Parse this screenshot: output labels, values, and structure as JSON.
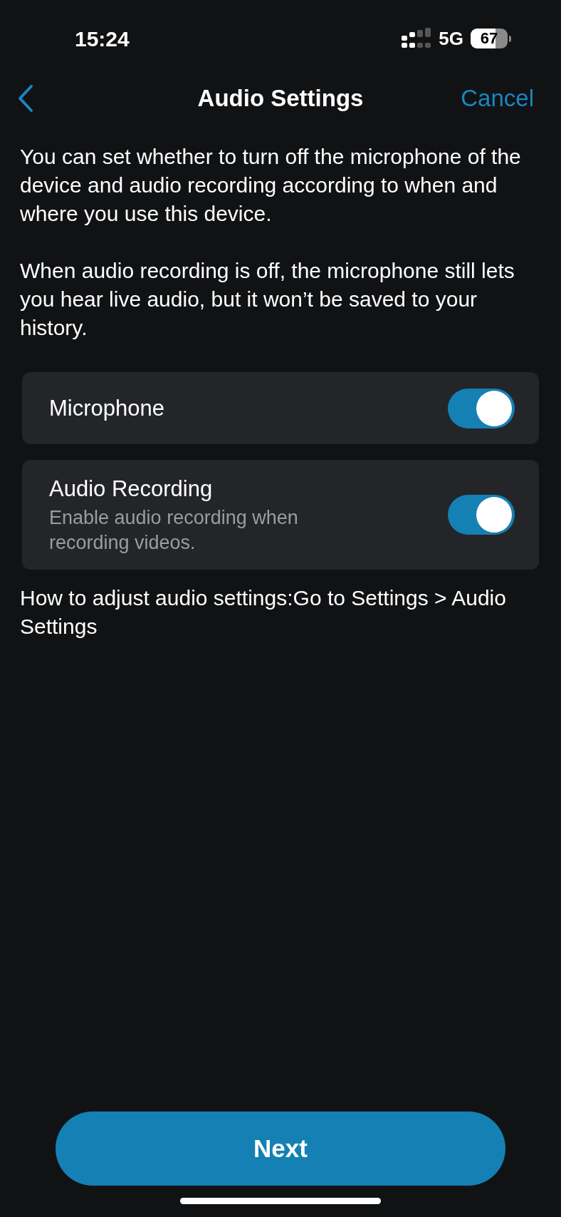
{
  "status_bar": {
    "time": "15:24",
    "network": "5G",
    "battery": "67"
  },
  "nav": {
    "title": "Audio Settings",
    "cancel": "Cancel"
  },
  "paragraphs": [
    "You can set whether to turn off the microphone of the device and audio recording according to when and where you use this device.",
    "When audio recording is off, the microphone still lets you hear live audio, but it won’t be saved to your history."
  ],
  "settings": [
    {
      "label": "Microphone",
      "on": true
    },
    {
      "label": "Audio Recording",
      "description": "Enable audio recording when recording videos.",
      "on": true
    }
  ],
  "help": "How to adjust audio settings:Go to Settings > Audio Settings",
  "next_button": "Next"
}
